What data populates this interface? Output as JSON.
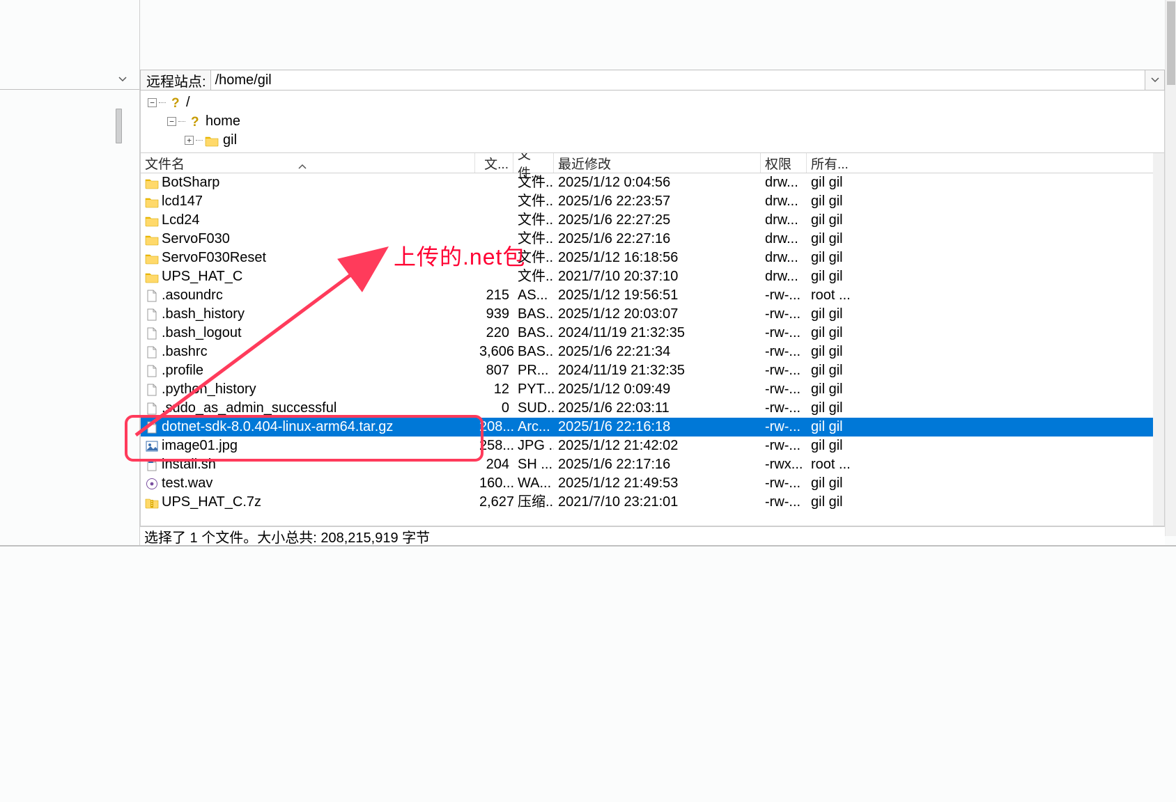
{
  "remote_label": "远程站点:",
  "remote_path": "/home/gil",
  "tree": {
    "root": {
      "name": "/",
      "label": "/"
    },
    "lvl1": {
      "name": "home",
      "label": "home"
    },
    "lvl2": {
      "name": "gil",
      "label": "gil"
    }
  },
  "columns": {
    "name": "文件名",
    "size": "文...",
    "type": "文件...",
    "mtime": "最近修改",
    "perm": "权限",
    "owner": "所有..."
  },
  "files": [
    {
      "icon": "folder",
      "name": "BotSharp",
      "size": "",
      "type": "文件...",
      "mtime": "2025/1/12 0:04:56",
      "perm": "drw...",
      "owner": "gil gil"
    },
    {
      "icon": "folder",
      "name": "lcd147",
      "size": "",
      "type": "文件...",
      "mtime": "2025/1/6 22:23:57",
      "perm": "drw...",
      "owner": "gil gil"
    },
    {
      "icon": "folder",
      "name": "Lcd24",
      "size": "",
      "type": "文件...",
      "mtime": "2025/1/6 22:27:25",
      "perm": "drw...",
      "owner": "gil gil"
    },
    {
      "icon": "folder",
      "name": "ServoF030",
      "size": "",
      "type": "文件...",
      "mtime": "2025/1/6 22:27:16",
      "perm": "drw...",
      "owner": "gil gil"
    },
    {
      "icon": "folder",
      "name": "ServoF030Reset",
      "size": "",
      "type": "文件...",
      "mtime": "2025/1/12 16:18:56",
      "perm": "drw...",
      "owner": "gil gil"
    },
    {
      "icon": "folder",
      "name": "UPS_HAT_C",
      "size": "",
      "type": "文件...",
      "mtime": "2021/7/10 20:37:10",
      "perm": "drw...",
      "owner": "gil gil"
    },
    {
      "icon": "file",
      "name": ".asoundrc",
      "size": "215",
      "type": "AS...",
      "mtime": "2025/1/12 19:56:51",
      "perm": "-rw-...",
      "owner": "root ..."
    },
    {
      "icon": "file",
      "name": ".bash_history",
      "size": "939",
      "type": "BAS...",
      "mtime": "2025/1/12 20:03:07",
      "perm": "-rw-...",
      "owner": "gil gil"
    },
    {
      "icon": "file",
      "name": ".bash_logout",
      "size": "220",
      "type": "BAS...",
      "mtime": "2024/11/19 21:32:35",
      "perm": "-rw-...",
      "owner": "gil gil"
    },
    {
      "icon": "file",
      "name": ".bashrc",
      "size": "3,606",
      "type": "BAS...",
      "mtime": "2025/1/6 22:21:34",
      "perm": "-rw-...",
      "owner": "gil gil"
    },
    {
      "icon": "file",
      "name": ".profile",
      "size": "807",
      "type": "PR...",
      "mtime": "2024/11/19 21:32:35",
      "perm": "-rw-...",
      "owner": "gil gil"
    },
    {
      "icon": "file",
      "name": ".python_history",
      "size": "12",
      "type": "PYT...",
      "mtime": "2025/1/12 0:09:49",
      "perm": "-rw-...",
      "owner": "gil gil"
    },
    {
      "icon": "file",
      "name": ".sudo_as_admin_successful",
      "size": "0",
      "type": "SUD...",
      "mtime": "2025/1/6 22:03:11",
      "perm": "-rw-...",
      "owner": "gil gil"
    },
    {
      "icon": "file",
      "name": "dotnet-sdk-8.0.404-linux-arm64.tar.gz",
      "size": "208...",
      "type": "Arc...",
      "mtime": "2025/1/6 22:16:18",
      "perm": "-rw-...",
      "owner": "gil gil",
      "selected": true
    },
    {
      "icon": "image",
      "name": "image01.jpg",
      "size": "258...",
      "type": "JPG ...",
      "mtime": "2025/1/12 21:42:02",
      "perm": "-rw-...",
      "owner": "gil gil"
    },
    {
      "icon": "script",
      "name": "install.sh",
      "size": "204",
      "type": "SH ...",
      "mtime": "2025/1/6 22:17:16",
      "perm": "-rwx...",
      "owner": "root ..."
    },
    {
      "icon": "audio",
      "name": "test.wav",
      "size": "160...",
      "type": "WA...",
      "mtime": "2025/1/12 21:49:53",
      "perm": "-rw-...",
      "owner": "gil gil"
    },
    {
      "icon": "archive",
      "name": "UPS_HAT_C.7z",
      "size": "2,627",
      "type": "压缩...",
      "mtime": "2021/7/10 23:21:01",
      "perm": "-rw-...",
      "owner": "gil gil"
    }
  ],
  "status": "选择了 1 个文件。大小总共: 208,215,919 字节",
  "annotation_text": "上传的.net包"
}
